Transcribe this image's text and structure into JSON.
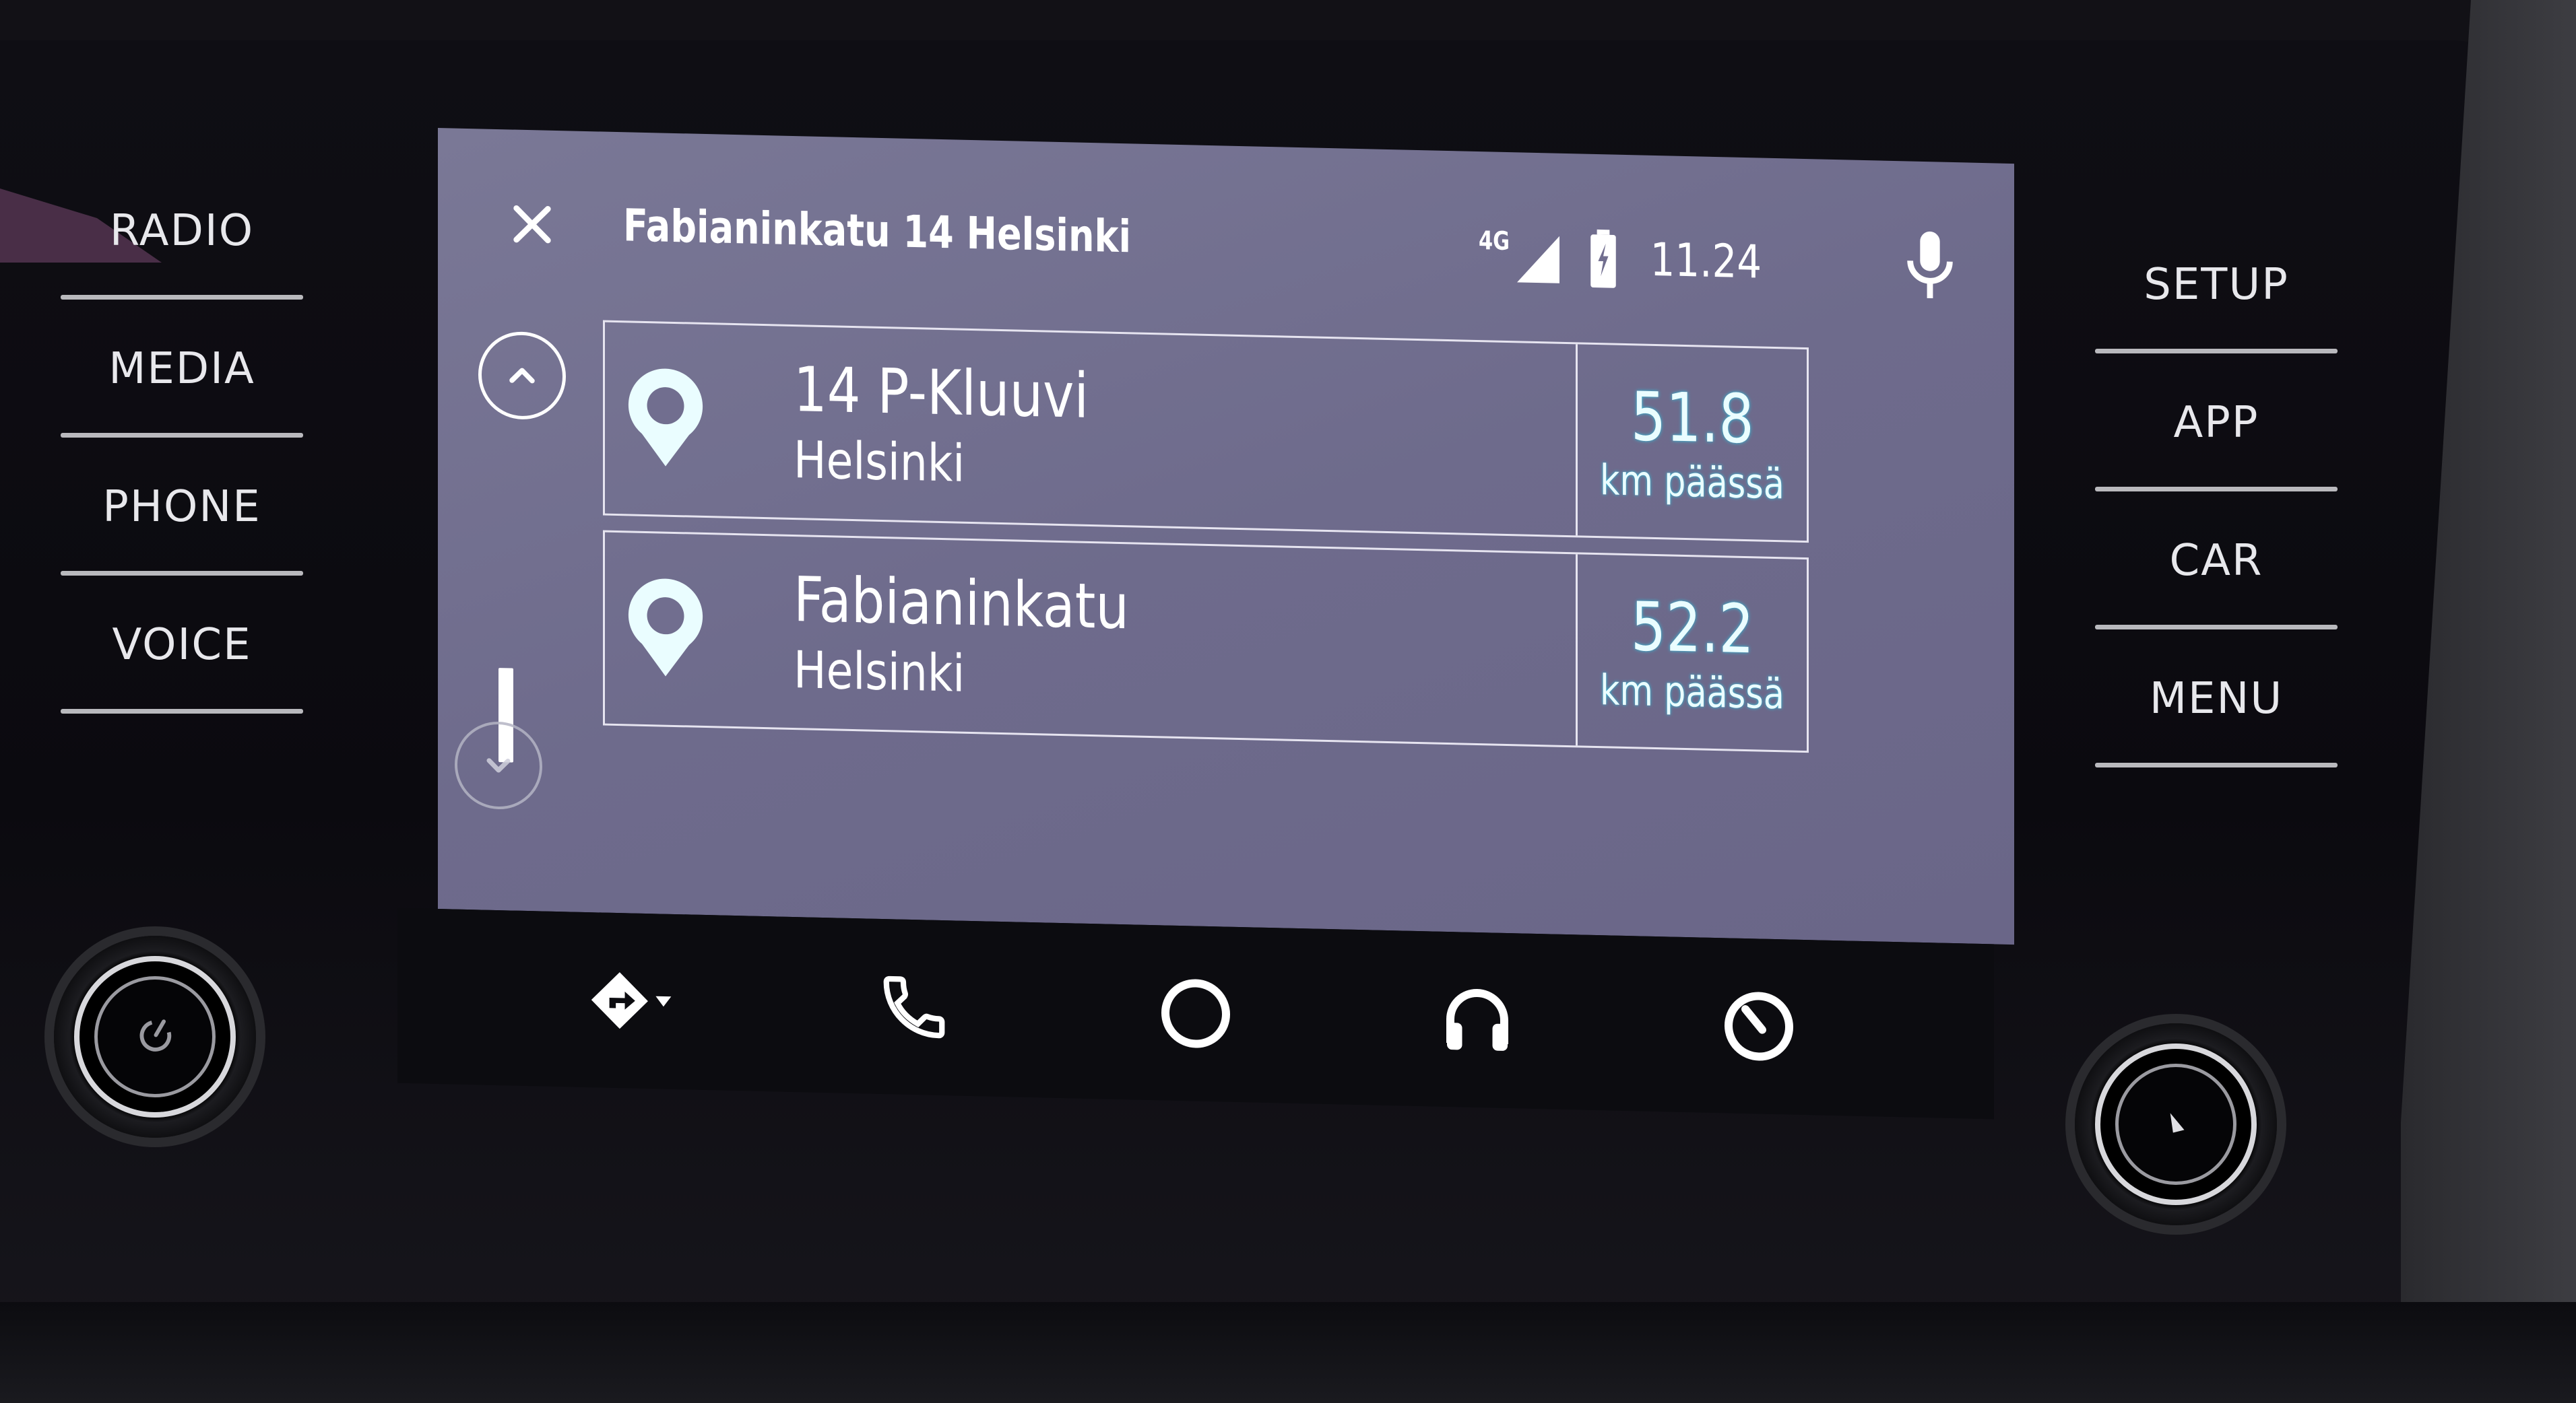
{
  "hardware_buttons": {
    "left": [
      {
        "label": "RADIO"
      },
      {
        "label": "MEDIA"
      },
      {
        "label": "PHONE"
      },
      {
        "label": "VOICE"
      }
    ],
    "right": [
      {
        "label": "SETUP"
      },
      {
        "label": "APP"
      },
      {
        "label": "CAR"
      },
      {
        "label": "MENU"
      }
    ],
    "knobs": [
      {
        "name": "power-volume-knob",
        "icon": "power-icon"
      },
      {
        "name": "tune-knob",
        "icon": "knob-indicator-icon"
      }
    ]
  },
  "screen": {
    "header": {
      "close_icon": "close-icon",
      "title": "Fabianinkatu 14 Helsinki",
      "network": "4G",
      "signal_icon": "signal-icon",
      "battery_icon": "battery-charging-icon",
      "time": "11.24",
      "mic_icon": "microphone-icon"
    },
    "scroll": {
      "up_icon": "chevron-up-icon",
      "down_icon": "chevron-down-icon"
    },
    "results": [
      {
        "name": "14 P-Kluuvi",
        "city": "Helsinki",
        "distance": "51.8",
        "unit": "km päässä",
        "icon": "place-pin-icon"
      },
      {
        "name": "Fabianinkatu",
        "city": "Helsinki",
        "distance": "52.2",
        "unit": "km päässä",
        "icon": "place-pin-icon"
      }
    ],
    "navbar": [
      {
        "name": "navigation",
        "icon": "navigation-directions-icon"
      },
      {
        "name": "phone",
        "icon": "phone-icon"
      },
      {
        "name": "home",
        "icon": "home-circle-icon"
      },
      {
        "name": "media",
        "icon": "headphones-icon"
      },
      {
        "name": "vehicle",
        "icon": "exit-gauge-icon"
      }
    ]
  },
  "colors": {
    "screen_bg": "#716e8f",
    "navbar_bg": "#0c0c10",
    "distance_glow": "#2ec4e0",
    "pin_color": "#eafdff"
  }
}
